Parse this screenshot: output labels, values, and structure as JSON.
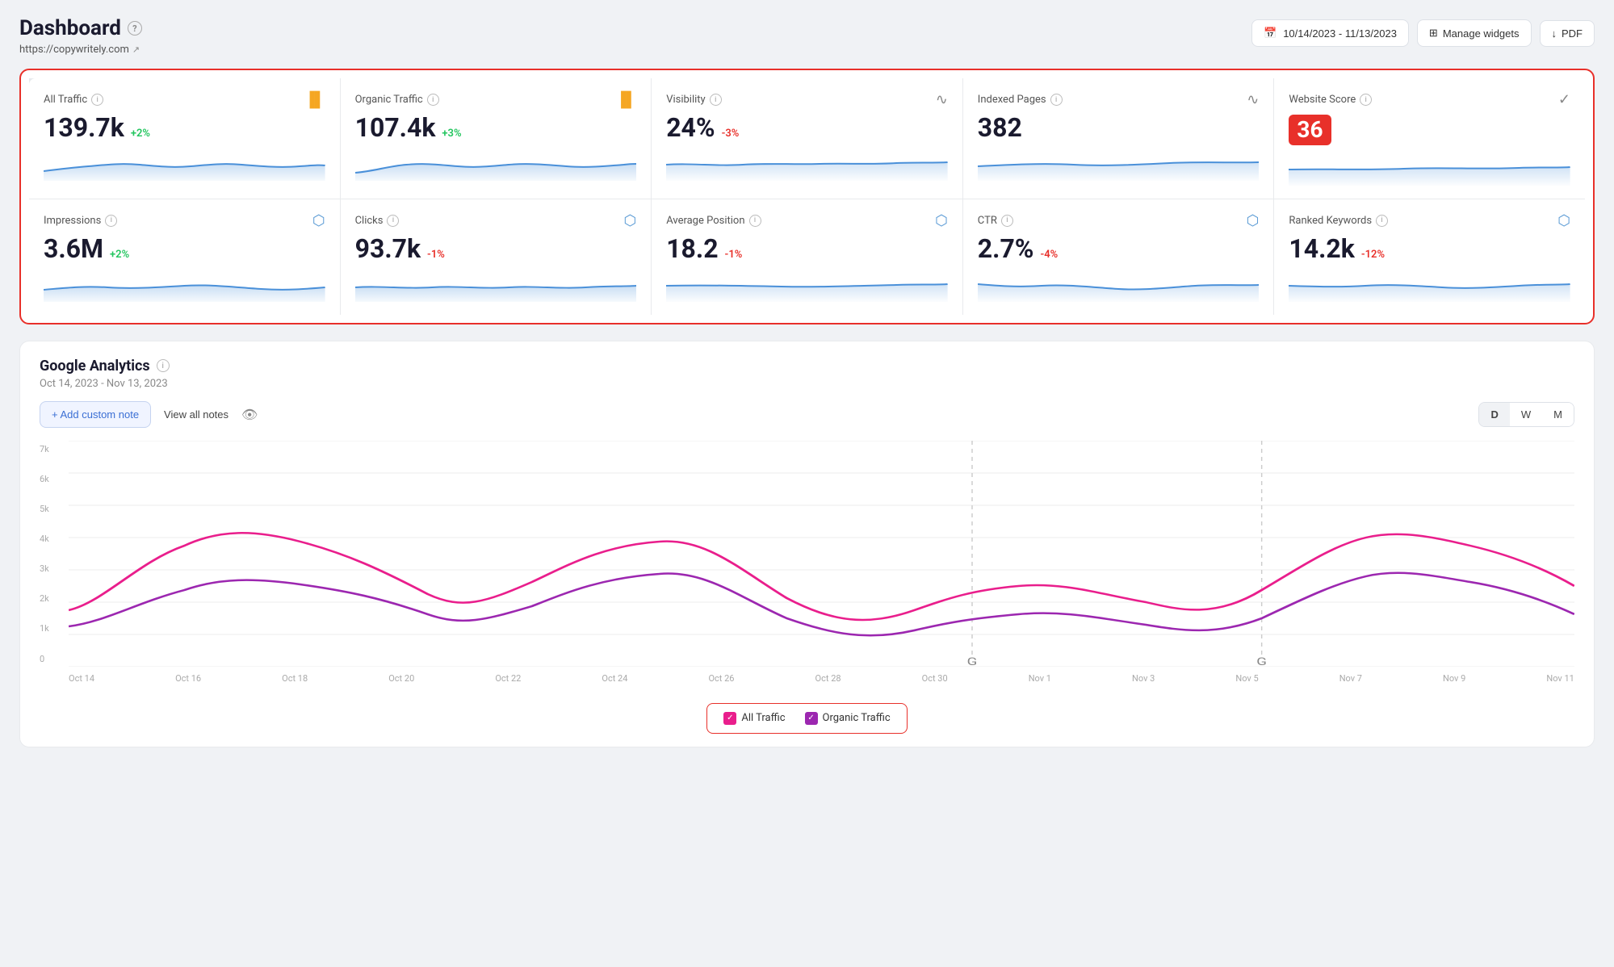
{
  "header": {
    "title": "Dashboard",
    "site_url": "https://copywritely.com",
    "date_range": "10/14/2023 - 11/13/2023",
    "manage_widgets_label": "Manage widgets",
    "pdf_label": "PDF"
  },
  "metrics": [
    {
      "id": "all-traffic",
      "label": "All Traffic",
      "value": "139.7k",
      "change": "+2%",
      "change_type": "positive",
      "icon_type": "bar-chart",
      "icon_color": "orange"
    },
    {
      "id": "organic-traffic",
      "label": "Organic Traffic",
      "value": "107.4k",
      "change": "+3%",
      "change_type": "positive",
      "icon_type": "bar-chart",
      "icon_color": "orange"
    },
    {
      "id": "visibility",
      "label": "Visibility",
      "value": "24%",
      "change": "-3%",
      "change_type": "negative",
      "icon_type": "trend",
      "icon_color": "gray"
    },
    {
      "id": "indexed-pages",
      "label": "Indexed Pages",
      "value": "382",
      "change": "",
      "change_type": "",
      "icon_type": "trend",
      "icon_color": "gray"
    },
    {
      "id": "website-score",
      "label": "Website Score",
      "value": "36",
      "change": "",
      "change_type": "",
      "badge": true,
      "icon_type": "check-circle",
      "icon_color": "gray"
    },
    {
      "id": "impressions",
      "label": "Impressions",
      "value": "3.6M",
      "change": "+2%",
      "change_type": "positive",
      "icon_type": "filter",
      "icon_color": "blue"
    },
    {
      "id": "clicks",
      "label": "Clicks",
      "value": "93.7k",
      "change": "-1%",
      "change_type": "negative",
      "icon_type": "filter",
      "icon_color": "blue"
    },
    {
      "id": "average-position",
      "label": "Average Position",
      "value": "18.2",
      "change": "-1%",
      "change_type": "negative",
      "icon_type": "filter",
      "icon_color": "blue"
    },
    {
      "id": "ctr",
      "label": "CTR",
      "value": "2.7%",
      "change": "-4%",
      "change_type": "negative",
      "icon_type": "filter",
      "icon_color": "blue"
    },
    {
      "id": "ranked-keywords",
      "label": "Ranked Keywords",
      "value": "14.2k",
      "change": "-12%",
      "change_type": "negative",
      "icon_type": "filter",
      "icon_color": "blue"
    }
  ],
  "analytics": {
    "title": "Google Analytics",
    "date_range": "Oct 14, 2023 - Nov 13, 2023",
    "add_note_label": "+ Add custom note",
    "view_notes_label": "View all notes",
    "period_buttons": [
      "D",
      "W",
      "M"
    ],
    "active_period": "D",
    "y_axis_labels": [
      "7k",
      "6k",
      "5k",
      "4k",
      "3k",
      "2k",
      "1k",
      "0"
    ],
    "x_axis_labels": [
      "Oct 14",
      "Oct 16",
      "Oct 18",
      "Oct 20",
      "Oct 22",
      "Oct 24",
      "Oct 26",
      "Oct 28",
      "Oct 30",
      "Nov 1",
      "Nov 3",
      "Nov 5",
      "Nov 7",
      "Nov 9",
      "Nov 11"
    ],
    "legend": [
      {
        "label": "All Traffic",
        "color": "pink"
      },
      {
        "label": "Organic Traffic",
        "color": "purple"
      }
    ]
  }
}
